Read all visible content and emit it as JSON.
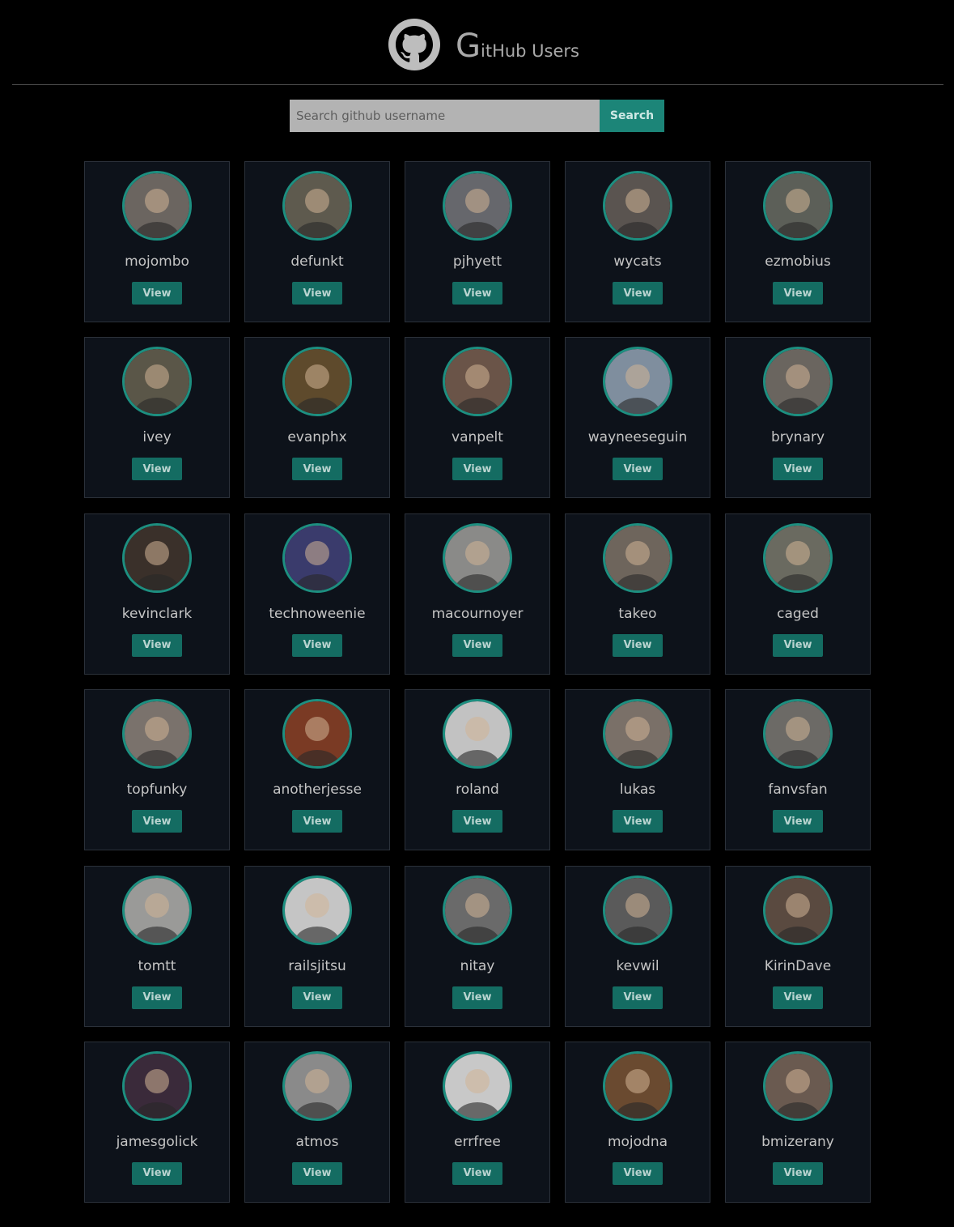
{
  "header": {
    "title_initial": "G",
    "title_rest": "itHub Users",
    "logo_icon": "github-octocat-icon"
  },
  "search": {
    "placeholder": "Search github username",
    "value": "",
    "button_label": "Search"
  },
  "colors": {
    "background": "#000000",
    "card_background": "#0d121a",
    "accent": "#1d8f80",
    "button": "#146c62"
  },
  "users": [
    {
      "login": "mojombo",
      "button_label": "View",
      "avatar_color": "#6b6560"
    },
    {
      "login": "defunkt",
      "button_label": "View",
      "avatar_color": "#5e5a4e"
    },
    {
      "login": "pjhyett",
      "button_label": "View",
      "avatar_color": "#66676c"
    },
    {
      "login": "wycats",
      "button_label": "View",
      "avatar_color": "#5a5450"
    },
    {
      "login": "ezmobius",
      "button_label": "View",
      "avatar_color": "#5c5f58"
    },
    {
      "login": "ivey",
      "button_label": "View",
      "avatar_color": "#5a5648"
    },
    {
      "login": "evanphx",
      "button_label": "View",
      "avatar_color": "#5e4a2c"
    },
    {
      "login": "vanpelt",
      "button_label": "View",
      "avatar_color": "#6a5448"
    },
    {
      "login": "wayneeseguin",
      "button_label": "View",
      "avatar_color": "#7f8e9e"
    },
    {
      "login": "brynary",
      "button_label": "View",
      "avatar_color": "#6a655f"
    },
    {
      "login": "kevinclark",
      "button_label": "View",
      "avatar_color": "#3a302a"
    },
    {
      "login": "technoweenie",
      "button_label": "View",
      "avatar_color": "#3a3b6c"
    },
    {
      "login": "macournoyer",
      "button_label": "View",
      "avatar_color": "#8a8a88"
    },
    {
      "login": "takeo",
      "button_label": "View",
      "avatar_color": "#6e655c"
    },
    {
      "login": "caged",
      "button_label": "View",
      "avatar_color": "#6a6a60"
    },
    {
      "login": "topfunky",
      "button_label": "View",
      "avatar_color": "#7a726c"
    },
    {
      "login": "anotherjesse",
      "button_label": "View",
      "avatar_color": "#7a3a24"
    },
    {
      "login": "roland",
      "button_label": "View",
      "avatar_color": "#c2c2c2"
    },
    {
      "login": "lukas",
      "button_label": "View",
      "avatar_color": "#7a7068"
    },
    {
      "login": "fanvsfan",
      "button_label": "View",
      "avatar_color": "#6c6a66"
    },
    {
      "login": "tomtt",
      "button_label": "View",
      "avatar_color": "#9a9a98"
    },
    {
      "login": "railsjitsu",
      "button_label": "View",
      "avatar_color": "#c5c5c5"
    },
    {
      "login": "nitay",
      "button_label": "View",
      "avatar_color": "#6a6a6a"
    },
    {
      "login": "kevwil",
      "button_label": "View",
      "avatar_color": "#5a5a5a"
    },
    {
      "login": "KirinDave",
      "button_label": "View",
      "avatar_color": "#5a4a40"
    },
    {
      "login": "jamesgolick",
      "button_label": "View",
      "avatar_color": "#3a2a3a"
    },
    {
      "login": "atmos",
      "button_label": "View",
      "avatar_color": "#8a8a8a"
    },
    {
      "login": "errfree",
      "button_label": "View",
      "avatar_color": "#c8c8c8"
    },
    {
      "login": "mojodna",
      "button_label": "View",
      "avatar_color": "#6a4a30"
    },
    {
      "login": "bmizerany",
      "button_label": "View",
      "avatar_color": "#6a5a50"
    }
  ]
}
